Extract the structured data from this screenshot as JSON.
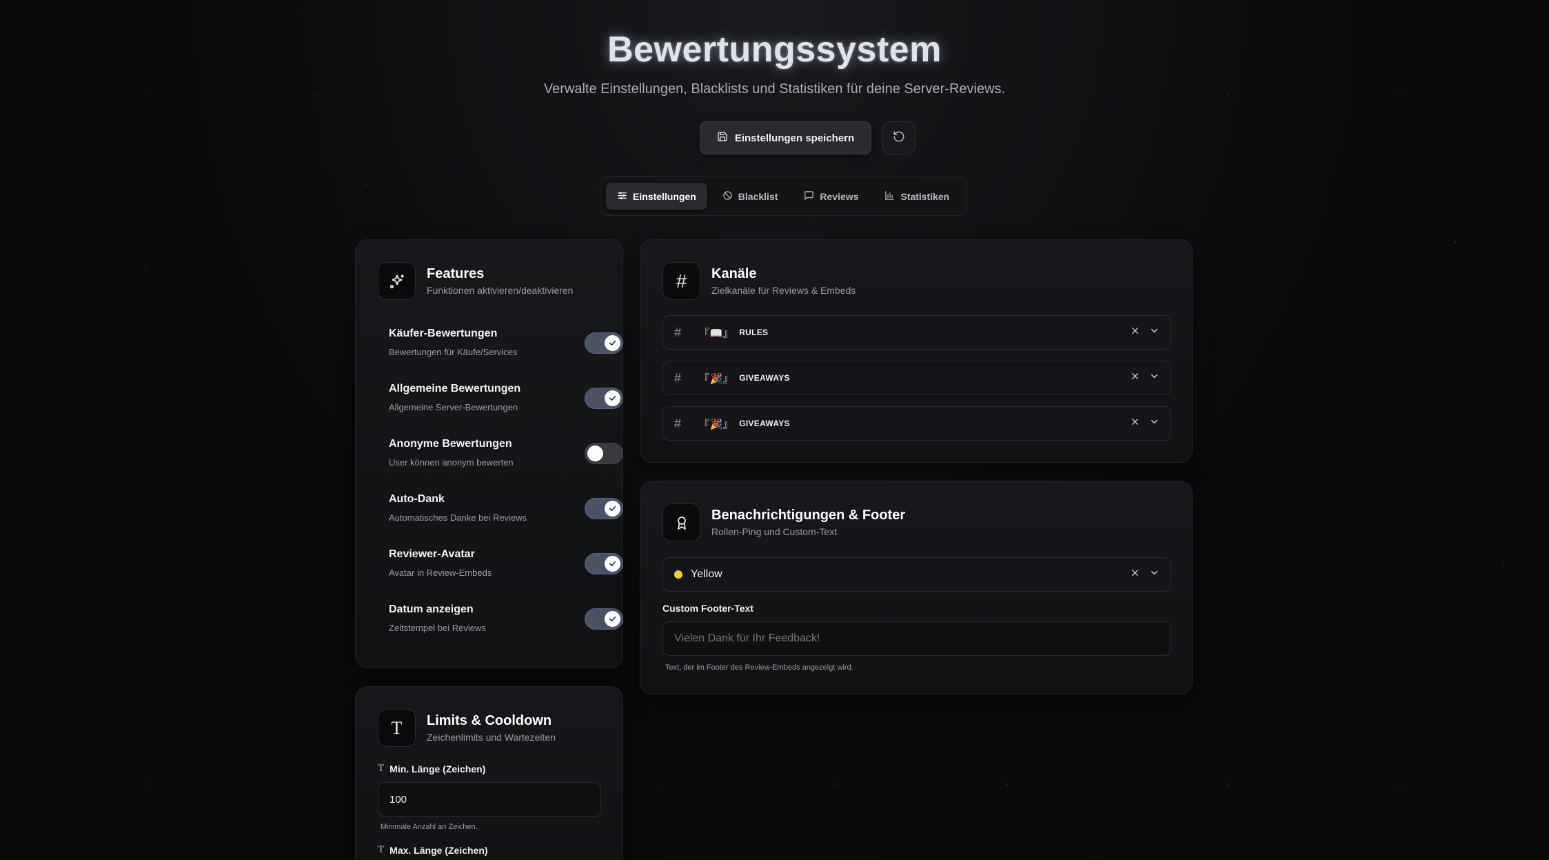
{
  "header": {
    "title": "Bewertungssystem",
    "subtitle": "Verwalte Einstellungen, Blacklists und Statistiken für deine Server-Reviews.",
    "save_label": "Einstellungen speichern"
  },
  "tabs": [
    {
      "label": "Einstellungen",
      "icon": "sliders-icon",
      "active": true
    },
    {
      "label": "Blacklist",
      "icon": "ban-icon",
      "active": false
    },
    {
      "label": "Reviews",
      "icon": "message-icon",
      "active": false
    },
    {
      "label": "Statistiken",
      "icon": "bar-chart-icon",
      "active": false
    }
  ],
  "features": {
    "title": "Features",
    "subtitle": "Funktionen aktivieren/deaktivieren",
    "items": [
      {
        "title": "Käufer-Bewertungen",
        "desc": "Bewertungen für Käufe/Services",
        "enabled": true
      },
      {
        "title": "Allgemeine Bewertungen",
        "desc": "Allgemeine Server-Bewertungen",
        "enabled": true
      },
      {
        "title": "Anonyme Bewertungen",
        "desc": "User können anonym bewerten",
        "enabled": false
      },
      {
        "title": "Auto-Dank",
        "desc": "Automatisches Danke bei Reviews",
        "enabled": true
      },
      {
        "title": "Reviewer-Avatar",
        "desc": "Avatar in Review-Embeds",
        "enabled": true
      },
      {
        "title": "Datum anzeigen",
        "desc": "Zeitstempel bei Reviews",
        "enabled": true
      }
    ]
  },
  "channels": {
    "title": "Kanäle",
    "subtitle": "Zielkanäle für Reviews & Embeds",
    "items": [
      {
        "tag": "『📖』",
        "name": "RULES"
      },
      {
        "tag": "『🎉』",
        "name": "GIVEAWAYS"
      },
      {
        "tag": "『🎉』",
        "name": "GIVEAWAYS"
      }
    ]
  },
  "notifications": {
    "title": "Benachrichtigungen & Footer",
    "subtitle": "Rollen-Ping und Custom-Text",
    "role_value": "Yellow",
    "role_color": "#f5d020",
    "footer_label": "Custom Footer-Text",
    "footer_placeholder": "Vielen Dank für Ihr Feedback!",
    "footer_hint": "Text, der im Footer des Review-Embeds angezeigt wird."
  },
  "limits": {
    "title": "Limits & Cooldown",
    "subtitle": "Zeichenlimits und Wartezeiten",
    "min_label": "Min. Länge (Zeichen)",
    "min_value": "100",
    "min_hint": "Minimale Anzahl an Zeichen.",
    "max_label": "Max. Länge (Zeichen)"
  }
}
